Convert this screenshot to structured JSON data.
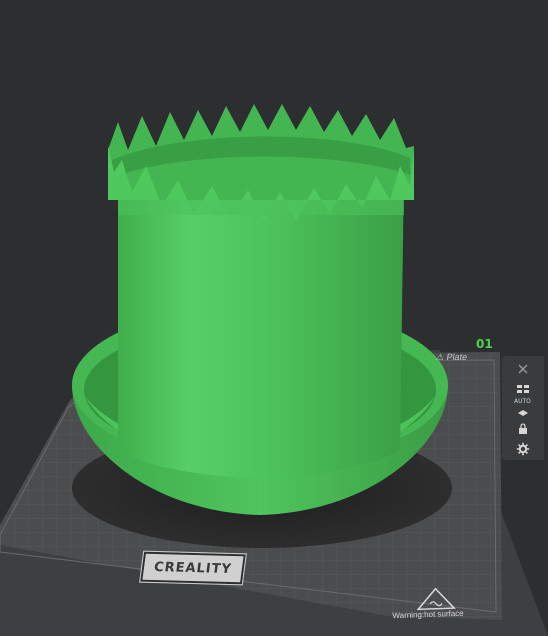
{
  "plate": {
    "number": "01",
    "name": "Plate"
  },
  "toolbar": {
    "tools": [
      {
        "name": "close-tool",
        "icon": "close-icon"
      },
      {
        "name": "arrange-tool",
        "icon": "arrange-icon"
      },
      {
        "name": "auto-orient-tool",
        "icon": "auto-orient-icon",
        "label": "AUTO"
      },
      {
        "name": "lock-tool",
        "icon": "lock-icon"
      },
      {
        "name": "settings-tool",
        "icon": "gear-icon"
      }
    ]
  },
  "bed": {
    "brand": "CREALITY",
    "warning": "Warning:hot surface"
  },
  "colors": {
    "background": "#2d2e30",
    "bed": "#4b4c4e",
    "model": "#4cc25a",
    "model_dark": "#3aa447",
    "accent": "#4fd14f"
  }
}
